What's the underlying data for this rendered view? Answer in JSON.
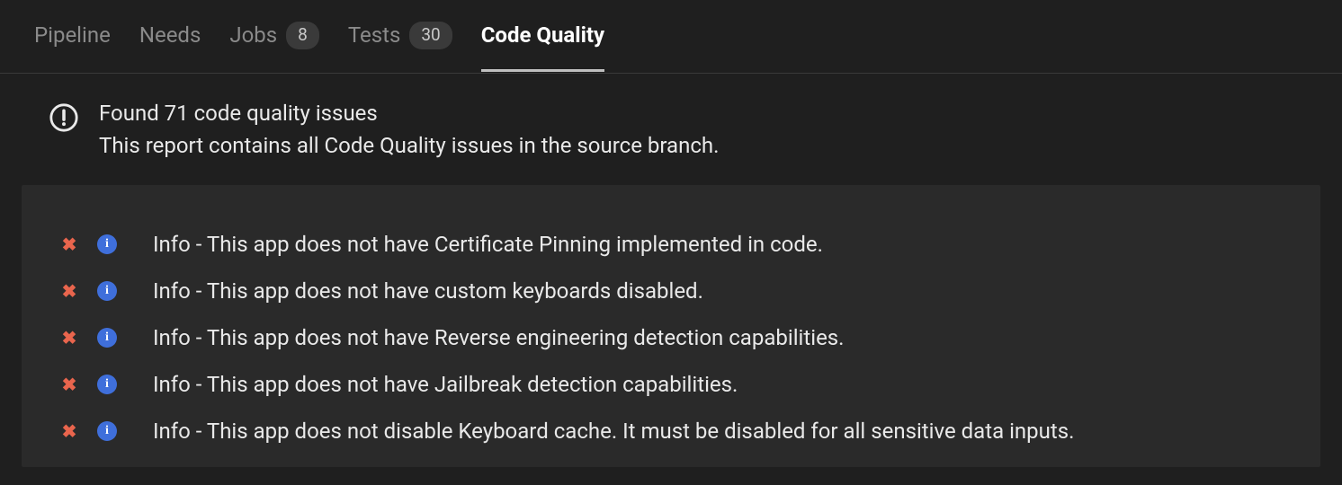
{
  "tabs": [
    {
      "label": "Pipeline",
      "badge": null,
      "active": false
    },
    {
      "label": "Needs",
      "badge": null,
      "active": false
    },
    {
      "label": "Jobs",
      "badge": "8",
      "active": false
    },
    {
      "label": "Tests",
      "badge": "30",
      "active": false
    },
    {
      "label": "Code Quality",
      "badge": null,
      "active": true
    }
  ],
  "summary": {
    "title": "Found 71 code quality issues",
    "description": "This report contains all Code Quality issues in the source branch."
  },
  "issues": [
    {
      "severity": "Info",
      "text": "Info - This app does not have Certificate Pinning implemented in code."
    },
    {
      "severity": "Info",
      "text": "Info - This app does not have custom keyboards disabled."
    },
    {
      "severity": "Info",
      "text": "Info - This app does not have Reverse engineering detection capabilities."
    },
    {
      "severity": "Info",
      "text": "Info - This app does not have Jailbreak detection capabilities."
    },
    {
      "severity": "Info",
      "text": "Info - This app does not disable Keyboard cache. It must be disabled for all sensitive data inputs."
    }
  ]
}
